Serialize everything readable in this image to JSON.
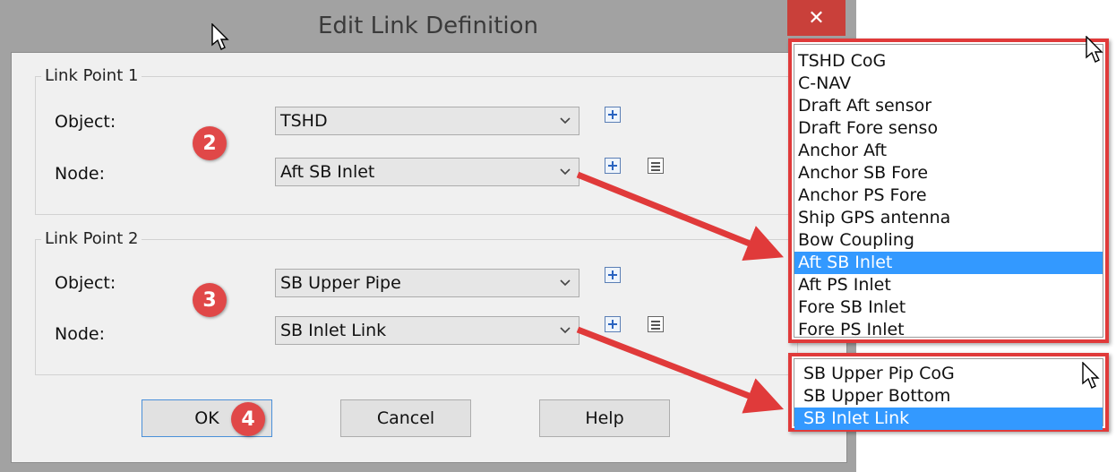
{
  "dialog": {
    "title": "Edit Link Definition",
    "close_glyph": "✕"
  },
  "link_point_1": {
    "group_label": "Link Point 1",
    "object_label": "Object:",
    "object_value": "TSHD",
    "node_label": "Node:",
    "node_value": "Aft SB Inlet"
  },
  "link_point_2": {
    "group_label": "Link Point 2",
    "object_label": "Object:",
    "object_value": "SB Upper Pipe",
    "node_label": "Node:",
    "node_value": "SB Inlet Link"
  },
  "buttons": {
    "ok": "OK",
    "cancel": "Cancel",
    "help": "Help"
  },
  "badges": {
    "b2": "2",
    "b3": "3",
    "b4": "4"
  },
  "node_list_1": {
    "items": [
      "TSHD CoG",
      "C-NAV",
      "Draft Aft sensor",
      "Draft Fore senso",
      "Anchor Aft",
      "Anchor SB Fore",
      "Anchor PS Fore",
      "Ship GPS antenna",
      "Bow Coupling",
      "Aft SB Inlet",
      "Aft PS Inlet",
      "Fore SB Inlet",
      "Fore PS Inlet"
    ],
    "selected": "Aft SB Inlet"
  },
  "node_list_2": {
    "items": [
      "SB Upper Pip CoG",
      "SB Upper Bottom",
      "SB Inlet Link"
    ],
    "selected": "SB Inlet Link"
  },
  "colors": {
    "highlight": "#3399ff",
    "annotation_red": "#e03a3a",
    "close_red": "#c9403a"
  }
}
